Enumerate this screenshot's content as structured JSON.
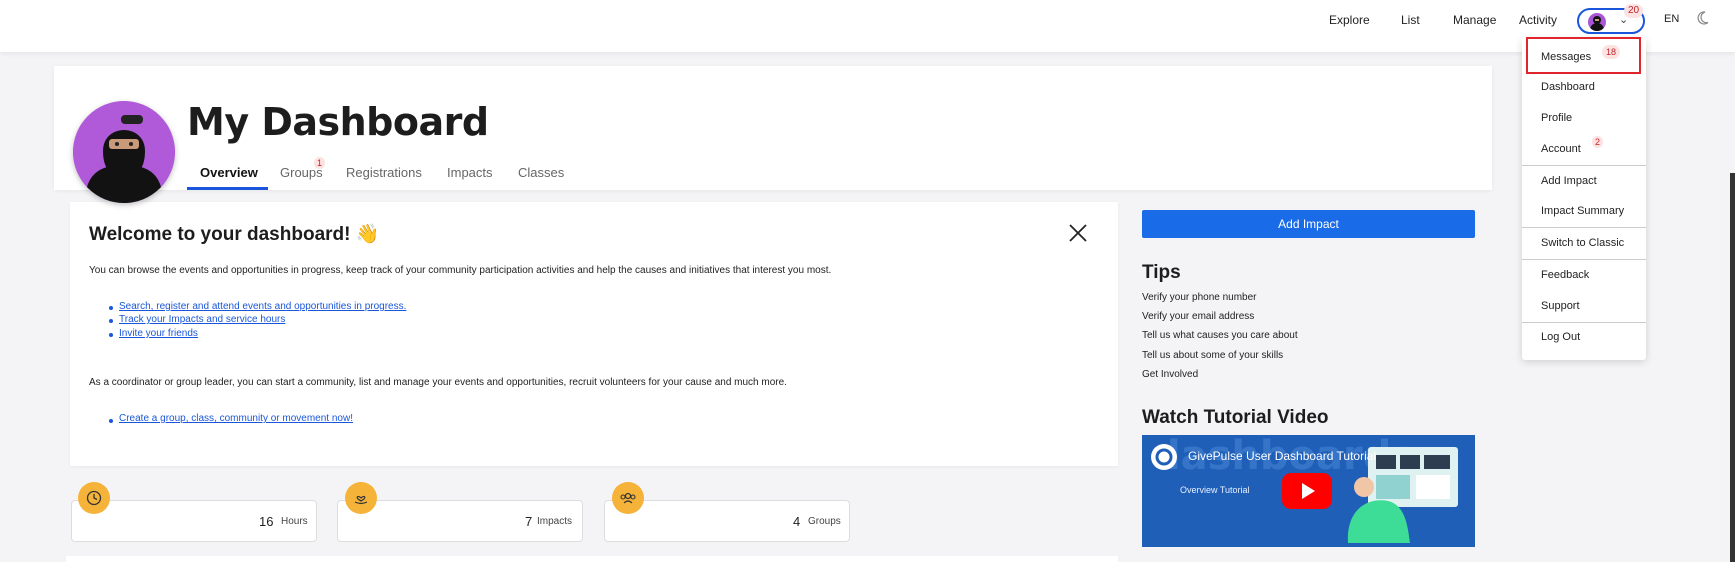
{
  "nav": {
    "links": [
      "Explore",
      "List",
      "Manage",
      "Activity"
    ],
    "notification_count": "20",
    "language": "EN"
  },
  "dropdown": {
    "items": [
      {
        "label": "Messages",
        "badge": "18"
      },
      {
        "label": "Dashboard"
      },
      {
        "label": "Profile"
      },
      {
        "label": "Account",
        "badge": "2"
      },
      {
        "label": "Add Impact"
      },
      {
        "label": "Impact Summary"
      },
      {
        "label": "Switch to Classic"
      },
      {
        "label": "Feedback"
      },
      {
        "label": "Support"
      },
      {
        "label": "Log Out"
      }
    ]
  },
  "header": {
    "title": "My Dashboard",
    "tabs": [
      {
        "label": "Overview",
        "active": true
      },
      {
        "label": "Groups",
        "badge": "1"
      },
      {
        "label": "Registrations"
      },
      {
        "label": "Impacts"
      },
      {
        "label": "Classes"
      }
    ]
  },
  "welcome": {
    "title": "Welcome to your dashboard! 👋",
    "intro": "You can browse the events and opportunities in progress, keep track of your community participation activities and help the causes and initiatives that interest you most.",
    "links": [
      "Search, register and attend events and opportunities in progress.",
      "Track your Impacts and service hours",
      "Invite your friends"
    ],
    "coordinator_text": "As a coordinator or group leader, you can start a community, list and manage your events and opportunities, recruit volunteers for your cause and much more.",
    "coordinator_link": "Create a group, class, community or movement now!"
  },
  "stats": [
    {
      "value": "16",
      "unit": "Hours",
      "icon": "clock-icon"
    },
    {
      "value": "7",
      "unit": "Impacts",
      "icon": "heart-hand-icon"
    },
    {
      "value": "4",
      "unit": "Groups",
      "icon": "group-icon"
    }
  ],
  "sidebar": {
    "add_impact": "Add Impact",
    "tips_title": "Tips",
    "tips": [
      "Verify your phone number",
      "Verify your email address",
      "Tell us what causes you care about",
      "Tell us about some of your skills",
      "Get Involved"
    ],
    "video_title": "Watch Tutorial Video",
    "video_caption": "GivePulse User Dashboard Tutorial",
    "video_subcaption": "Overview Tutorial",
    "video_big_text": "dashboards"
  },
  "colors": {
    "accent": "#1a56db",
    "button": "#1a6be8",
    "badge_bg": "#fde2e2",
    "badge_fg": "#c0262d",
    "highlight": "#e0262c",
    "stat_icon": "#f5b33a",
    "avatar": "#b05ad9"
  }
}
